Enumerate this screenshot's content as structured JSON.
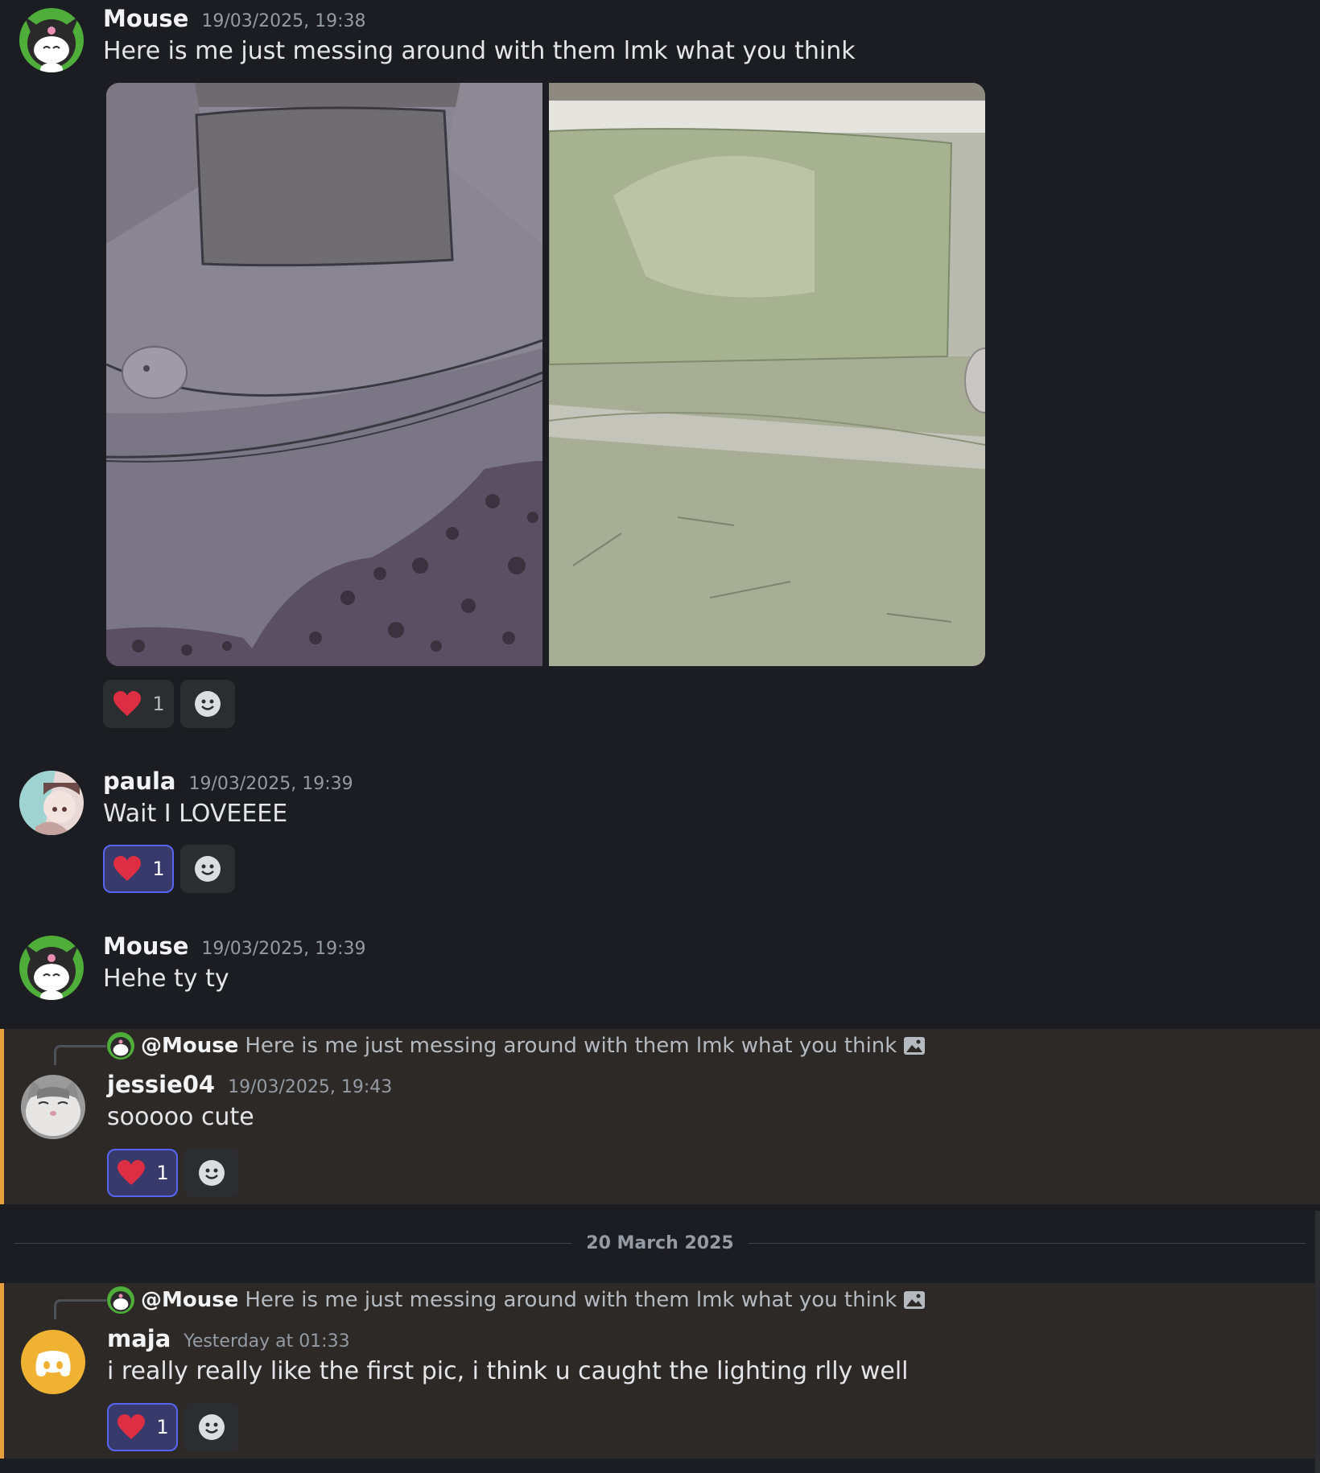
{
  "messages": [
    {
      "author": "Mouse",
      "timestamp": "19/03/2025, 19:38",
      "text": "Here is me just messing around with them lmk what you think",
      "reactions": [
        {
          "emoji": "heart",
          "count": "1",
          "active": false
        }
      ]
    },
    {
      "author": "paula",
      "timestamp": "19/03/2025, 19:39",
      "text": "Wait I LOVEEEE",
      "reactions": [
        {
          "emoji": "heart",
          "count": "1",
          "active": true
        }
      ]
    },
    {
      "author": "Mouse",
      "timestamp": "19/03/2025, 19:39",
      "text": "Hehe ty ty"
    },
    {
      "reply_to": {
        "mention": "@Mouse",
        "text": "Here is me just messing around with them lmk what you think"
      },
      "author": "jessie04",
      "timestamp": "19/03/2025, 19:43",
      "text": "sooooo cute",
      "reactions": [
        {
          "emoji": "heart",
          "count": "1",
          "active": true
        }
      ]
    },
    {
      "reply_to": {
        "mention": "@Mouse",
        "text": "Here is me just messing around with them lmk what you think"
      },
      "author": "maja",
      "timestamp": "Yesterday at 01:33",
      "text": "i really really like the first pic, i think u caught the lighting rlly well",
      "reactions": [
        {
          "emoji": "heart",
          "count": "1",
          "active": true
        }
      ]
    }
  ],
  "date_divider": "20 March 2025",
  "colors": {
    "background": "#1c1d22",
    "highlight": "#2d2926",
    "highlight_border": "#e9a23b",
    "reaction_active": "#5865f2",
    "maja_avatar": "#f0b232"
  }
}
